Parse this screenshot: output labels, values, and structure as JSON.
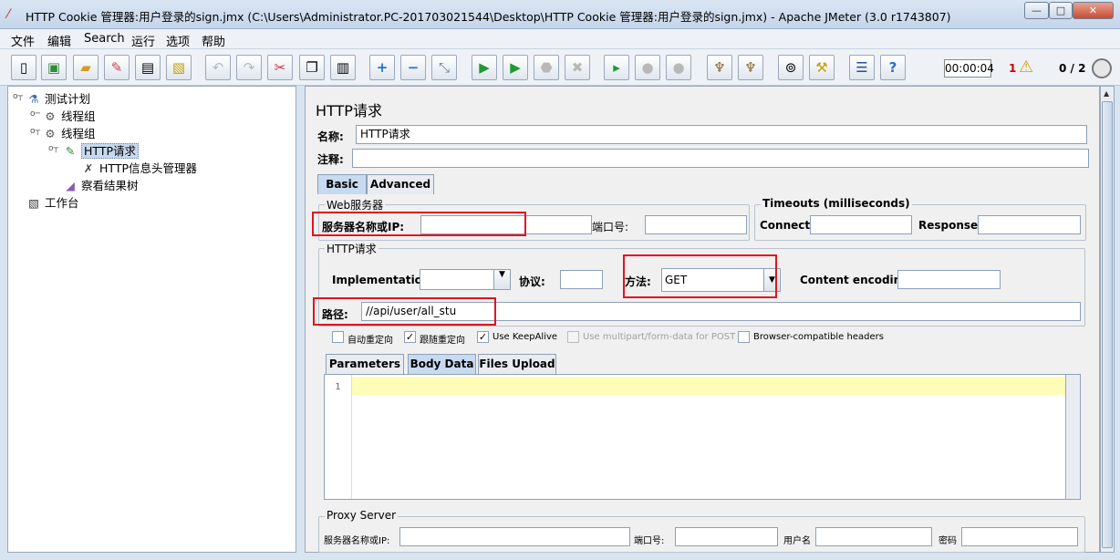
{
  "window": {
    "title": "HTTP Cookie 管理器:用户登录的sign.jmx (C:\\Users\\Administrator.PC-201703021544\\Desktop\\HTTP Cookie 管理器:用户登录的sign.jmx) - Apache JMeter (3.0 r1743807)",
    "min": "—",
    "max": "□",
    "close": "✕"
  },
  "menu": [
    "文件",
    "编辑",
    "Search",
    "运行",
    "选项",
    "帮助"
  ],
  "toolbar": {
    "timer": "00:00:04",
    "error_count": "1",
    "thread_count": "0 / 2"
  },
  "tree": {
    "root": "测试计划",
    "group1": "线程组",
    "group2": "线程组",
    "http_request": "HTTP请求",
    "header_manager": "HTTP信息头管理器",
    "result_tree": "察看结果树",
    "workbench": "工作台"
  },
  "panel": {
    "heading": "HTTP请求",
    "name_label": "名称:",
    "name_value": "HTTP请求",
    "comment_label": "注释:",
    "comment_value": "",
    "tabs": [
      "Basic",
      "Advanced"
    ],
    "web_server": {
      "legend": "Web服务器",
      "server_label": "服务器名称或IP:",
      "server_value": "",
      "port_label": "端口号:",
      "port_value": ""
    },
    "timeouts": {
      "legend": "Timeouts (milliseconds)",
      "connect_label": "Connect:",
      "connect_value": "",
      "response_label": "Response:",
      "response_value": ""
    },
    "http_request": {
      "legend": "HTTP请求",
      "impl_label": "Implementation:",
      "impl_value": "",
      "protocol_label": "协议:",
      "protocol_value": "",
      "method_label": "方法:",
      "method_value": "GET",
      "encoding_label": "Content encoding:",
      "encoding_value": "",
      "path_label": "路径:",
      "path_value": "//api/user/all_stu"
    },
    "options": [
      {
        "label": "自动重定向",
        "checked": false,
        "disabled": false
      },
      {
        "label": "跟随重定向",
        "checked": true,
        "disabled": false
      },
      {
        "label": "Use KeepAlive",
        "checked": true,
        "disabled": false
      },
      {
        "label": "Use multipart/form-data for POST",
        "checked": false,
        "disabled": true
      },
      {
        "label": "Browser-compatible headers",
        "checked": false,
        "disabled": false
      }
    ],
    "body_tabs": [
      "Parameters",
      "Body Data",
      "Files Upload"
    ],
    "editor_line": "1",
    "proxy": {
      "legend": "Proxy Server",
      "server_label": "服务器名称或IP:",
      "port_label": "端口号:",
      "user_label": "用户名",
      "password_label": "密码"
    }
  }
}
